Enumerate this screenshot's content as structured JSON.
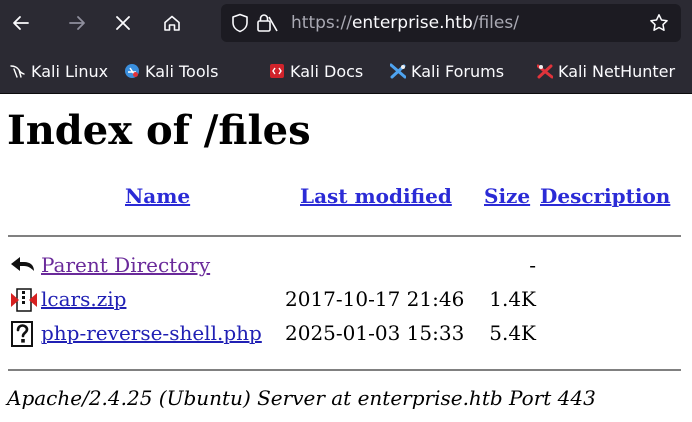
{
  "browser": {
    "url_scheme": "https://",
    "url_host": "enterprise.htb",
    "url_path": "/files/",
    "bookmarks": [
      {
        "label": "Kali Linux",
        "icon": "kali-dragon-icon"
      },
      {
        "label": "Kali Tools",
        "icon": "kali-tools-icon"
      },
      {
        "label": "Kali Docs",
        "icon": "kali-docs-icon"
      },
      {
        "label": "Kali Forums",
        "icon": "kali-forums-icon"
      },
      {
        "label": "Kali NetHunter",
        "icon": "kali-nethunter-icon"
      }
    ]
  },
  "page": {
    "title": "Index of /files",
    "columns": {
      "name": "Name",
      "last_modified": "Last modified",
      "size": "Size",
      "description": "Description"
    },
    "rows": [
      {
        "icon": "back-arrow-icon",
        "name": "Parent Directory",
        "modified": "",
        "size": "-",
        "description": ""
      },
      {
        "icon": "compressed-file-icon",
        "name": "lcars.zip",
        "modified": "2017-10-17 21:46",
        "size": "1.4K",
        "description": ""
      },
      {
        "icon": "unknown-file-icon",
        "name": "php-reverse-shell.php",
        "modified": "2025-01-03 15:33",
        "size": "5.4K",
        "description": ""
      }
    ],
    "address": "Apache/2.4.25 (Ubuntu) Server at enterprise.htb Port 443"
  }
}
